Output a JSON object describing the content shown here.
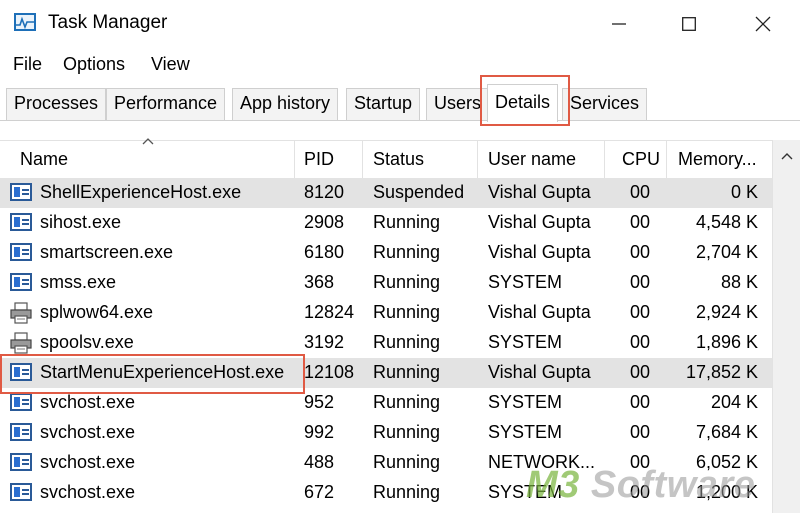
{
  "window": {
    "title": "Task Manager"
  },
  "menu": [
    "File",
    "Options",
    "View"
  ],
  "tabs": [
    "Processes",
    "Performance",
    "App history",
    "Startup",
    "Users",
    "Details",
    "Services"
  ],
  "active_tab": "Details",
  "columns": [
    "Name",
    "PID",
    "Status",
    "User name",
    "CPU",
    "Memory..."
  ],
  "rows": [
    {
      "name": "ShellExperienceHost.exe",
      "pid": "8120",
      "status": "Suspended",
      "user": "Vishal Gupta",
      "cpu": "00",
      "memory": "0 K",
      "icon": "app-window-icon"
    },
    {
      "name": "sihost.exe",
      "pid": "2908",
      "status": "Running",
      "user": "Vishal Gupta",
      "cpu": "00",
      "memory": "4,548 K",
      "icon": "app-window-icon"
    },
    {
      "name": "smartscreen.exe",
      "pid": "6180",
      "status": "Running",
      "user": "Vishal Gupta",
      "cpu": "00",
      "memory": "2,704 K",
      "icon": "app-window-icon"
    },
    {
      "name": "smss.exe",
      "pid": "368",
      "status": "Running",
      "user": "SYSTEM",
      "cpu": "00",
      "memory": "88 K",
      "icon": "app-window-icon"
    },
    {
      "name": "splwow64.exe",
      "pid": "12824",
      "status": "Running",
      "user": "Vishal Gupta",
      "cpu": "00",
      "memory": "2,924 K",
      "icon": "printer-icon"
    },
    {
      "name": "spoolsv.exe",
      "pid": "3192",
      "status": "Running",
      "user": "SYSTEM",
      "cpu": "00",
      "memory": "1,896 K",
      "icon": "printer-icon"
    },
    {
      "name": "StartMenuExperienceHost.exe",
      "pid": "12108",
      "status": "Running",
      "user": "Vishal Gupta",
      "cpu": "00",
      "memory": "17,852 K",
      "icon": "app-window-icon"
    },
    {
      "name": "svchost.exe",
      "pid": "952",
      "status": "Running",
      "user": "SYSTEM",
      "cpu": "00",
      "memory": "204 K",
      "icon": "app-window-icon"
    },
    {
      "name": "svchost.exe",
      "pid": "992",
      "status": "Running",
      "user": "SYSTEM",
      "cpu": "00",
      "memory": "7,684 K",
      "icon": "app-window-icon"
    },
    {
      "name": "svchost.exe",
      "pid": "488",
      "status": "Running",
      "user": "NETWORK...",
      "cpu": "00",
      "memory": "6,052 K",
      "icon": "app-window-icon"
    },
    {
      "name": "svchost.exe",
      "pid": "672",
      "status": "Running",
      "user": "SYSTEM",
      "cpu": "00",
      "memory": "1,200 K",
      "icon": "app-window-icon"
    }
  ],
  "selected_rows": [
    0,
    6
  ],
  "highlighted_row": 6,
  "watermark": {
    "prefix": "M3",
    "text": "Software"
  },
  "colors": {
    "highlight": "#e05a44",
    "selection": "#e3e3e3",
    "icon_blue": "#2a6ed0"
  }
}
